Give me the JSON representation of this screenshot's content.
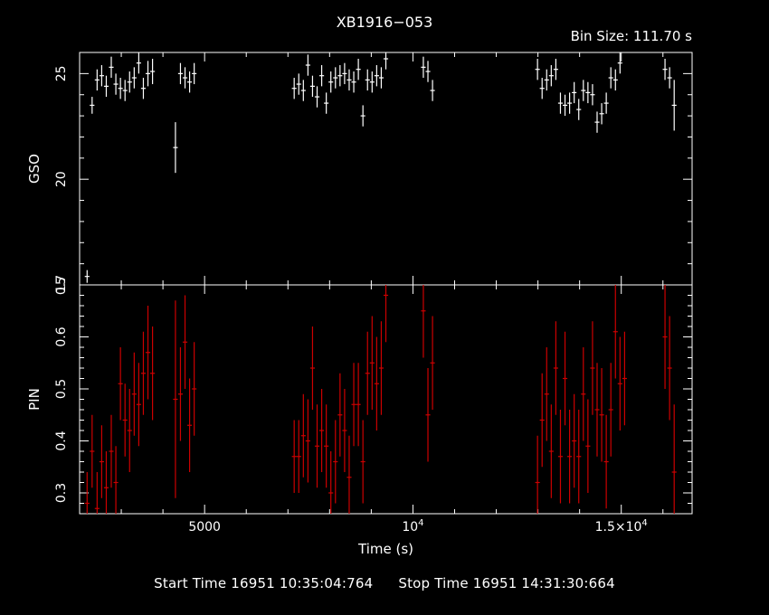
{
  "title": "XB1916−053",
  "bin_size_label": "Bin Size: 111.70 s",
  "footer": {
    "start_label": "Start Time 16951 10:35:04:764",
    "stop_label": "Stop Time 16951 14:31:30:664"
  },
  "colors": {
    "background": "#000000",
    "axes": "#ffffff",
    "gso": "#ffffff",
    "pin": "#cc0000"
  },
  "chart_data": [
    {
      "type": "scatter",
      "panel": "top",
      "series": [
        {
          "name": "GSO"
        }
      ],
      "ylabel": "GSO",
      "xlim": [
        2000,
        16700
      ],
      "ylim": [
        15,
        26
      ],
      "y_ticks": [
        15,
        20,
        25
      ],
      "y_tick_labels": [
        "15",
        "20",
        "25"
      ],
      "x_bin_halfwidth": 55.85,
      "points": [
        [
          2180,
          15.4,
          0.3
        ],
        [
          2300,
          23.5,
          0.4
        ],
        [
          2420,
          24.7,
          0.5
        ],
        [
          2530,
          24.9,
          0.5
        ],
        [
          2640,
          24.4,
          0.5
        ],
        [
          2760,
          25.3,
          0.5
        ],
        [
          2870,
          24.5,
          0.5
        ],
        [
          2980,
          24.3,
          0.5
        ],
        [
          3090,
          24.2,
          0.5
        ],
        [
          3200,
          24.6,
          0.5
        ],
        [
          3310,
          24.8,
          0.5
        ],
        [
          3420,
          25.5,
          0.5
        ],
        [
          3530,
          24.3,
          0.5
        ],
        [
          3640,
          25.0,
          0.6
        ],
        [
          3750,
          25.1,
          0.6
        ],
        [
          4300,
          21.5,
          1.2
        ],
        [
          4420,
          25.0,
          0.5
        ],
        [
          4530,
          24.8,
          0.5
        ],
        [
          4640,
          24.6,
          0.5
        ],
        [
          4750,
          25.0,
          0.5
        ],
        [
          7150,
          24.3,
          0.5
        ],
        [
          7260,
          24.5,
          0.5
        ],
        [
          7370,
          24.2,
          0.5
        ],
        [
          7480,
          25.4,
          0.5
        ],
        [
          7590,
          24.4,
          0.5
        ],
        [
          7700,
          23.9,
          0.5
        ],
        [
          7810,
          24.9,
          0.5
        ],
        [
          7920,
          23.6,
          0.5
        ],
        [
          8030,
          24.6,
          0.5
        ],
        [
          8140,
          24.8,
          0.5
        ],
        [
          8250,
          24.9,
          0.5
        ],
        [
          8360,
          25.0,
          0.5
        ],
        [
          8470,
          24.7,
          0.5
        ],
        [
          8580,
          24.6,
          0.5
        ],
        [
          8690,
          25.2,
          0.5
        ],
        [
          8800,
          23.0,
          0.5
        ],
        [
          8910,
          24.7,
          0.5
        ],
        [
          9020,
          24.6,
          0.5
        ],
        [
          9130,
          24.9,
          0.5
        ],
        [
          9240,
          24.8,
          0.5
        ],
        [
          9350,
          25.7,
          0.5
        ],
        [
          10250,
          25.3,
          0.5
        ],
        [
          10360,
          25.1,
          0.5
        ],
        [
          10470,
          24.2,
          0.5
        ],
        [
          12990,
          25.2,
          0.5
        ],
        [
          13100,
          24.3,
          0.5
        ],
        [
          13210,
          24.7,
          0.5
        ],
        [
          13320,
          24.9,
          0.5
        ],
        [
          13430,
          25.2,
          0.5
        ],
        [
          13540,
          23.6,
          0.5
        ],
        [
          13650,
          23.5,
          0.5
        ],
        [
          13760,
          23.6,
          0.5
        ],
        [
          13870,
          24.1,
          0.5
        ],
        [
          13980,
          23.3,
          0.5
        ],
        [
          14090,
          24.2,
          0.5
        ],
        [
          14200,
          24.1,
          0.5
        ],
        [
          14310,
          24.0,
          0.5
        ],
        [
          14420,
          22.7,
          0.5
        ],
        [
          14530,
          23.1,
          0.5
        ],
        [
          14640,
          23.6,
          0.5
        ],
        [
          14750,
          24.8,
          0.5
        ],
        [
          14860,
          24.7,
          0.5
        ],
        [
          14970,
          25.5,
          0.5
        ],
        [
          16050,
          25.2,
          0.5
        ],
        [
          16160,
          24.8,
          0.5
        ],
        [
          16270,
          23.5,
          1.2
        ]
      ]
    },
    {
      "type": "scatter",
      "panel": "bottom",
      "series": [
        {
          "name": "PIN"
        }
      ],
      "ylabel": "PIN",
      "xlabel": "Time (s)",
      "xlim": [
        2000,
        16700
      ],
      "ylim": [
        0.26,
        0.7
      ],
      "y_ticks": [
        0.3,
        0.4,
        0.5,
        0.6,
        0.7
      ],
      "y_tick_labels": [
        "0.3",
        "0.4",
        "0.5",
        "0.6",
        "0.7"
      ],
      "x_ticks": [
        5000,
        10000,
        15000
      ],
      "x_tick_labels": [
        "5000",
        "10",
        "1.5×10"
      ],
      "x_tick_exponents": [
        "",
        "4",
        "4"
      ],
      "x_bin_halfwidth": 55.85,
      "points": [
        [
          2180,
          0.28,
          0.06
        ],
        [
          2300,
          0.38,
          0.07
        ],
        [
          2420,
          0.27,
          0.07
        ],
        [
          2530,
          0.36,
          0.07
        ],
        [
          2640,
          0.31,
          0.07
        ],
        [
          2760,
          0.38,
          0.07
        ],
        [
          2870,
          0.32,
          0.07
        ],
        [
          2980,
          0.51,
          0.07
        ],
        [
          3090,
          0.44,
          0.07
        ],
        [
          3200,
          0.42,
          0.08
        ],
        [
          3310,
          0.49,
          0.08
        ],
        [
          3420,
          0.47,
          0.08
        ],
        [
          3530,
          0.53,
          0.08
        ],
        [
          3640,
          0.57,
          0.09
        ],
        [
          3750,
          0.53,
          0.09
        ],
        [
          4300,
          0.48,
          0.19
        ],
        [
          4420,
          0.49,
          0.09
        ],
        [
          4530,
          0.59,
          0.09
        ],
        [
          4640,
          0.43,
          0.09
        ],
        [
          4750,
          0.5,
          0.09
        ],
        [
          7150,
          0.37,
          0.07
        ],
        [
          7260,
          0.37,
          0.07
        ],
        [
          7370,
          0.41,
          0.08
        ],
        [
          7480,
          0.4,
          0.08
        ],
        [
          7590,
          0.54,
          0.08
        ],
        [
          7700,
          0.39,
          0.08
        ],
        [
          7810,
          0.42,
          0.08
        ],
        [
          7920,
          0.39,
          0.08
        ],
        [
          8030,
          0.3,
          0.08
        ],
        [
          8140,
          0.36,
          0.08
        ],
        [
          8250,
          0.45,
          0.08
        ],
        [
          8360,
          0.42,
          0.08
        ],
        [
          8470,
          0.33,
          0.08
        ],
        [
          8580,
          0.47,
          0.08
        ],
        [
          8690,
          0.47,
          0.08
        ],
        [
          8800,
          0.36,
          0.08
        ],
        [
          8910,
          0.53,
          0.08
        ],
        [
          9020,
          0.55,
          0.09
        ],
        [
          9130,
          0.51,
          0.09
        ],
        [
          9240,
          0.54,
          0.09
        ],
        [
          9350,
          0.68,
          0.09
        ],
        [
          10250,
          0.65,
          0.09
        ],
        [
          10360,
          0.45,
          0.09
        ],
        [
          10470,
          0.55,
          0.09
        ],
        [
          12990,
          0.32,
          0.09
        ],
        [
          13100,
          0.44,
          0.09
        ],
        [
          13210,
          0.49,
          0.09
        ],
        [
          13320,
          0.38,
          0.09
        ],
        [
          13430,
          0.54,
          0.09
        ],
        [
          13540,
          0.37,
          0.09
        ],
        [
          13650,
          0.52,
          0.09
        ],
        [
          13760,
          0.37,
          0.09
        ],
        [
          13870,
          0.4,
          0.09
        ],
        [
          13980,
          0.37,
          0.09
        ],
        [
          14090,
          0.49,
          0.09
        ],
        [
          14200,
          0.39,
          0.09
        ],
        [
          14310,
          0.54,
          0.09
        ],
        [
          14420,
          0.46,
          0.09
        ],
        [
          14530,
          0.45,
          0.09
        ],
        [
          14640,
          0.36,
          0.09
        ],
        [
          14750,
          0.46,
          0.09
        ],
        [
          14860,
          0.61,
          0.09
        ],
        [
          14970,
          0.51,
          0.09
        ],
        [
          15080,
          0.52,
          0.09
        ],
        [
          16050,
          0.6,
          0.1
        ],
        [
          16160,
          0.54,
          0.1
        ],
        [
          16270,
          0.34,
          0.13
        ]
      ]
    }
  ]
}
